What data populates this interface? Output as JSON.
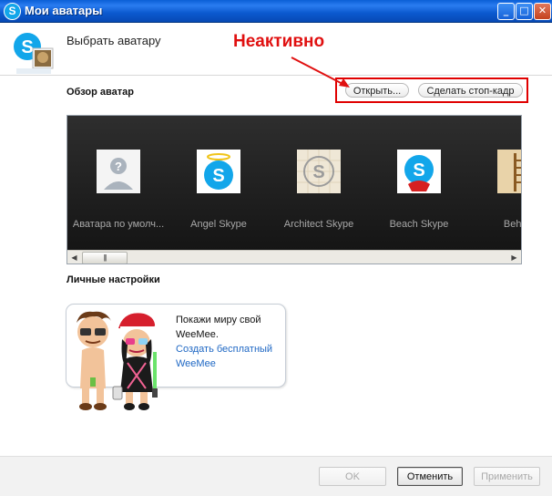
{
  "window": {
    "title": "Мои аватары",
    "minimize_label": "_",
    "maximize_label": "□",
    "close_label": "✕",
    "app_icon_letter": "S"
  },
  "header": {
    "title": "Выбрать аватару",
    "annotation": "Неактивно"
  },
  "overview": {
    "label": "Обзор аватар",
    "open_button": "Открыть...",
    "snapshot_button": "Сделать стоп-кадр",
    "items": [
      {
        "label": "Аватара по умолч...",
        "icon": "default-avatar-icon"
      },
      {
        "label": "Angel Skype",
        "icon": "angel-skype-icon"
      },
      {
        "label": "Architect Skype",
        "icon": "architect-skype-icon"
      },
      {
        "label": "Beach Skype",
        "icon": "beach-skype-icon"
      },
      {
        "label": "Behind",
        "icon": "behind-icon"
      }
    ],
    "scroll_thumb": "|||"
  },
  "personal": {
    "label": "Личные настройки",
    "weemee_text": "Покажи миру свой WeeMee.",
    "weemee_link": "Создать бесплатный WeeMee"
  },
  "footer": {
    "ok": "OK",
    "cancel": "Отменить",
    "apply": "Применить"
  },
  "colors": {
    "accent_blue": "#0b59cf",
    "annotation_red": "#e01010",
    "skype_blue": "#12a6ea"
  }
}
